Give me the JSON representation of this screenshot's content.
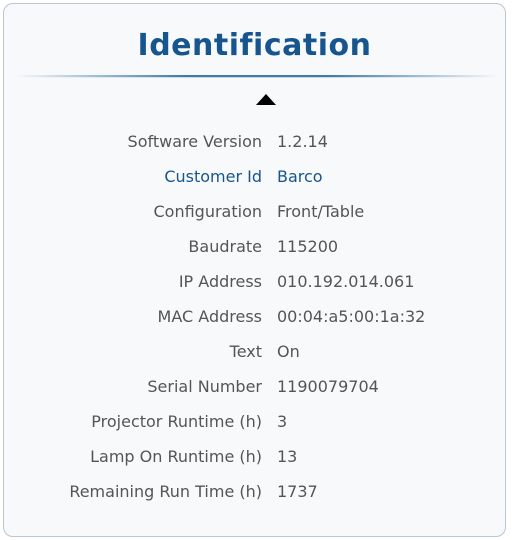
{
  "title": "Identification",
  "colors": {
    "title": "#17558f",
    "highlight": "#17558f",
    "text": "#555555",
    "background": "#f7f9fb",
    "border": "#b9c6d3"
  },
  "scroll_icon": "triangle-up-icon",
  "rows": [
    {
      "label": "Software Version",
      "value": "1.2.14"
    },
    {
      "label": "Customer Id",
      "value": "Barco",
      "highlighted": true
    },
    {
      "label": "Configuration",
      "value": "Front/Table"
    },
    {
      "label": "Baudrate",
      "value": "115200"
    },
    {
      "label": "IP Address",
      "value": "010.192.014.061"
    },
    {
      "label": "MAC Address",
      "value": "00:04:a5:00:1a:32"
    },
    {
      "label": "Text",
      "value": "On"
    },
    {
      "label": "Serial Number",
      "value": "1190079704"
    },
    {
      "label": "Projector Runtime (h)",
      "value": "3"
    },
    {
      "label": "Lamp On Runtime (h)",
      "value": "13"
    },
    {
      "label": "Remaining Run Time (h)",
      "value": "1737"
    }
  ]
}
